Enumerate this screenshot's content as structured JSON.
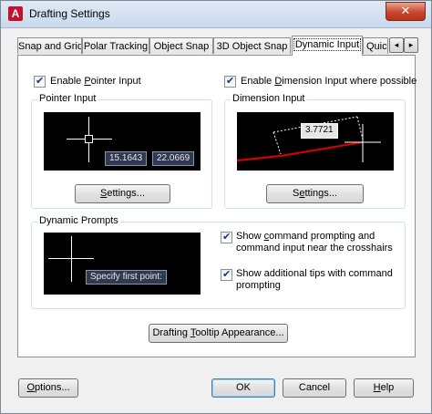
{
  "window": {
    "title": "Drafting Settings",
    "close_glyph": "✕",
    "app_icon_glyph": "A",
    "app_icon": "autocad-icon"
  },
  "tabs": [
    {
      "label": "Snap and Grid"
    },
    {
      "label": "Polar Tracking"
    },
    {
      "label": "Object Snap"
    },
    {
      "label": "3D Object Snap"
    },
    {
      "label": "Dynamic Input",
      "active": true
    },
    {
      "label": "Quic"
    }
  ],
  "tab_scroll": {
    "left_glyph": "◂",
    "right_glyph": "▸"
  },
  "pointer": {
    "enable_label_pre": "Enable ",
    "enable_label_u": "P",
    "enable_label_post": "ointer Input",
    "enable_checked": true,
    "group_title": "Pointer Input",
    "coord_x": "15.1643",
    "coord_y": "22.0669",
    "settings_pre": "",
    "settings_u": "S",
    "settings_post": "ettings..."
  },
  "dimension": {
    "enable_label_pre": "Enable ",
    "enable_label_u": "D",
    "enable_label_post": "imension Input where possible",
    "enable_checked": true,
    "group_title": "Dimension Input",
    "value": "3.7721",
    "settings_pre": "S",
    "settings_u": "e",
    "settings_post": "ttings..."
  },
  "prompts": {
    "group_title": "Dynamic Prompts",
    "preview_text": "Specify first point:",
    "show_cmd_line1_pre": "Show ",
    "show_cmd_line1_u": "c",
    "show_cmd_line1_post": "ommand prompting and",
    "show_cmd_line2": "command input near the crosshairs",
    "show_cmd_checked": true,
    "show_tips_line1": "Show additional tips with command",
    "show_tips_line2": "prompting",
    "show_tips_checked": true
  },
  "tooltip_button": {
    "pre": "Drafting ",
    "u": "T",
    "post": "ooltip Appearance..."
  },
  "footer": {
    "options_pre": "",
    "options_u": "O",
    "options_post": "ptions...",
    "ok": "OK",
    "cancel": "Cancel",
    "help_pre": "",
    "help_u": "H",
    "help_post": "elp"
  },
  "colors": {
    "preview_bg": "#000000",
    "dim_line": "#e00000",
    "tip_bg": "#2f3a52",
    "accent": "#3c7fb1"
  }
}
